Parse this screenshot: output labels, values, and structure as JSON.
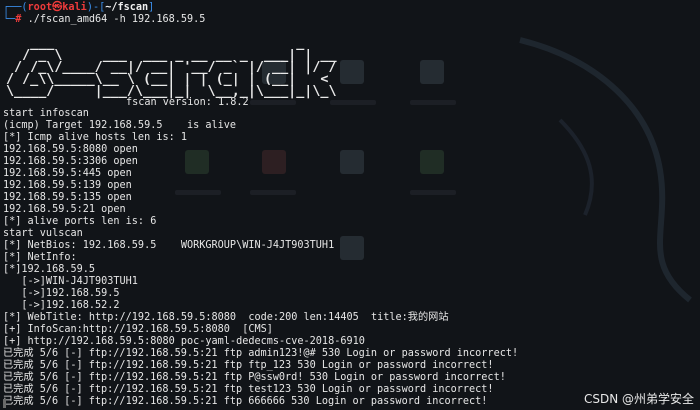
{
  "prompt": {
    "user": "root",
    "at_symbol": "㉿",
    "host": "kali",
    "path": "~/fscan",
    "command": "./fscan_amd64 -h 192.168.59.5"
  },
  "banner": {
    "ascii_lines": [
      "   ___                              _    ",
      "  / _ \\     ___  ___ _ __ __ _  ___| | __ ",
      " / /_\\/____/ __|/ __| '__/ _` |/ __| |/ / ",
      "/ /_\\\\_____\\__ \\ (__| | | (_| | (__|   <  ",
      "\\____/     |___/\\___|_|  \\__,_|\\___|_|\\_\\ "
    ],
    "version": "fscan version: 1.8.2"
  },
  "output_lines": [
    "start infoscan",
    "(icmp) Target 192.168.59.5    is alive",
    "[*] Icmp alive hosts len is: 1",
    "192.168.59.5:8080 open",
    "192.168.59.5:3306 open",
    "192.168.59.5:445 open",
    "192.168.59.5:139 open",
    "192.168.59.5:135 open",
    "192.168.59.5:21 open",
    "[*] alive ports len is: 6",
    "start vulscan",
    "[*] NetBios: 192.168.59.5    WORKGROUP\\WIN-J4JT903TUH1",
    "[*] NetInfo:",
    "[*]192.168.59.5",
    "   [->]WIN-J4JT903TUH1",
    "   [->]192.168.59.5",
    "   [->]192.168.52.2",
    "[*] WebTitle: http://192.168.59.5:8080  code:200 len:14405  title:我的网站",
    "[+] InfoScan:http://192.168.59.5:8080  [CMS]",
    "[+] http://192.168.59.5:8080 poc-yaml-dedecms-cve-2018-6910",
    "已完成 5/6 [-] ftp://192.168.59.5:21 ftp admin123!@# 530 Login or password incorrect!",
    "已完成 5/6 [-] ftp://192.168.59.5:21 ftp ftp_123 530 Login or password incorrect!",
    "已完成 5/6 [-] ftp://192.168.59.5:21 ftp P@ssw0rd! 530 Login or password incorrect!",
    "已完成 5/6 [-] ftp://192.168.59.5:21 ftp test123 530 Login or password incorrect!",
    "已完成 5/6 [-] ftp://192.168.59.5:21 ftp 666666 530 Login or password incorrect!"
  ],
  "watermark": "CSDN @州弟学安全",
  "colors": {
    "background": "#111418",
    "text": "#e6e6e6",
    "prompt_frame": "#3b8eea",
    "prompt_user": "#ef3b3b"
  }
}
